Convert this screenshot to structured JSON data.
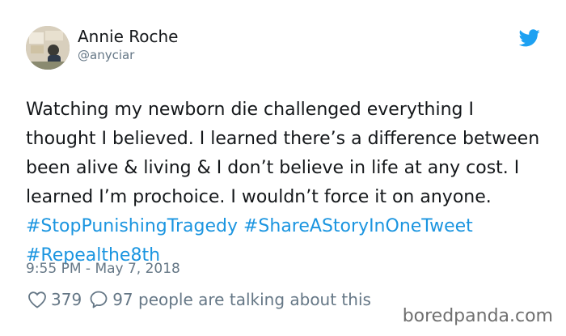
{
  "author": {
    "name": "Annie Roche",
    "handle": "@anyciar",
    "avatar_icon": "profile-photo"
  },
  "brand": {
    "icon": "twitter-bird-icon",
    "color": "#1da1f2"
  },
  "tweet": {
    "text_parts": [
      {
        "text": "Watching my newborn die challenged everything I thought I believed. I learned there’s a difference between been alive & living & I don’t believe in life at any cost. I learned I’m prochoice. I wouldn’t force it on anyone. ",
        "type": "text"
      },
      {
        "text": "#StopPunishingTragedy",
        "type": "hashtag"
      },
      {
        "text": " ",
        "type": "text"
      },
      {
        "text": "#ShareAStoryInOneTweet",
        "type": "hashtag"
      },
      {
        "text": " ",
        "type": "text"
      },
      {
        "text": "#Repealthe8th",
        "type": "hashtag"
      }
    ],
    "timestamp": "9:55 PM - May 7, 2018"
  },
  "engagement": {
    "like_icon": "heart-icon",
    "like_count": "379",
    "reply_icon": "reply-bubble-icon",
    "reply_text": "97 people are talking about this"
  },
  "colors": {
    "hashtag": "#1b95e0",
    "secondary_text": "#657786",
    "primary_text": "#14171a"
  },
  "watermark": "boredpanda.com"
}
